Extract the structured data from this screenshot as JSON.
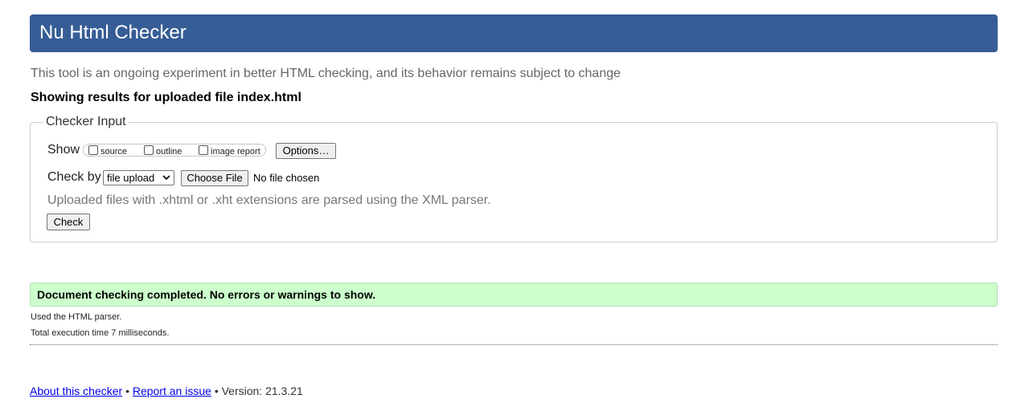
{
  "header": {
    "title": "Nu Html Checker"
  },
  "tagline": "This tool is an ongoing experiment in better HTML checking, and its behavior remains subject to change",
  "results_heading": "Showing results for uploaded file index.html",
  "checker_input": {
    "legend": "Checker Input",
    "show_label": "Show",
    "show_options": [
      {
        "label": "source",
        "checked": false
      },
      {
        "label": "outline",
        "checked": false
      },
      {
        "label": "image report",
        "checked": false
      }
    ],
    "options_button": "Options…",
    "check_by_label": "Check by",
    "check_by_value": "file upload",
    "choose_file_button": "Choose File",
    "file_status": "No file chosen",
    "parser_note": "Uploaded files with .xhtml or .xht extensions are parsed using the XML parser.",
    "check_button": "Check"
  },
  "result": {
    "message": "Document checking completed. No errors or warnings to show.",
    "parser_used": "Used the HTML parser.",
    "execution_time": "Total execution time 7 milliseconds."
  },
  "footer": {
    "about_link": "About this checker",
    "separator": "•",
    "report_link": "Report an issue",
    "version_text": "Version: 21.3.21"
  },
  "colors": {
    "header_bg": "#365d95",
    "success_bg": "#ccffcc",
    "link": "#0000ee"
  }
}
